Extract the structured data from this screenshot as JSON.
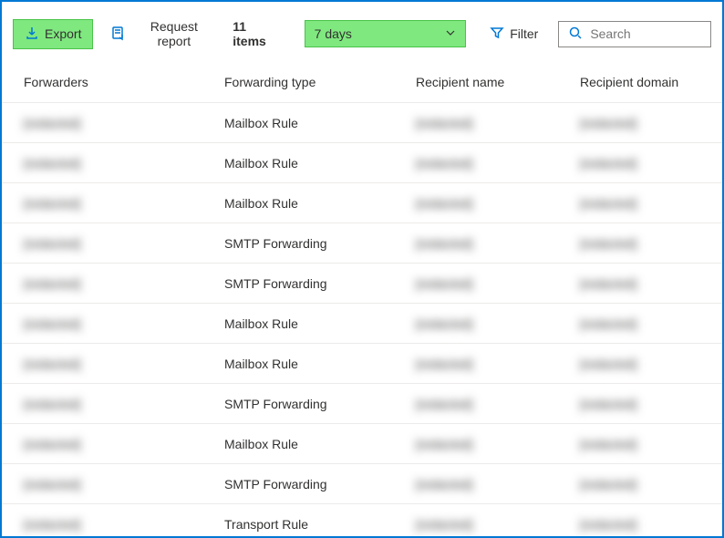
{
  "toolbar": {
    "export_label": "Export",
    "request_report_label": "Request report",
    "item_count": "11 items",
    "date_range": "7 days",
    "filter_label": "Filter",
    "search_placeholder": "Search"
  },
  "columns": {
    "forwarders": "Forwarders",
    "forwarding_type": "Forwarding type",
    "recipient_name": "Recipient name",
    "recipient_domain": "Recipient domain"
  },
  "rows": [
    {
      "forwarders": "[redacted]",
      "type": "Mailbox Rule",
      "name": "[redacted]",
      "domain": "[redacted]"
    },
    {
      "forwarders": "[redacted]",
      "type": "Mailbox Rule",
      "name": "[redacted]",
      "domain": "[redacted]"
    },
    {
      "forwarders": "[redacted]",
      "type": "Mailbox Rule",
      "name": "[redacted]",
      "domain": "[redacted]"
    },
    {
      "forwarders": "[redacted]",
      "type": "SMTP Forwarding",
      "name": "[redacted]",
      "domain": "[redacted]"
    },
    {
      "forwarders": "[redacted]",
      "type": "SMTP Forwarding",
      "name": "[redacted]",
      "domain": "[redacted]"
    },
    {
      "forwarders": "[redacted]",
      "type": "Mailbox Rule",
      "name": "[redacted]",
      "domain": "[redacted]"
    },
    {
      "forwarders": "[redacted]",
      "type": "Mailbox Rule",
      "name": "[redacted]",
      "domain": "[redacted]"
    },
    {
      "forwarders": "[redacted]",
      "type": "SMTP Forwarding",
      "name": "[redacted]",
      "domain": "[redacted]"
    },
    {
      "forwarders": "[redacted]",
      "type": "Mailbox Rule",
      "name": "[redacted]",
      "domain": "[redacted]"
    },
    {
      "forwarders": "[redacted]",
      "type": "SMTP Forwarding",
      "name": "[redacted]",
      "domain": "[redacted]"
    },
    {
      "forwarders": "[redacted]",
      "type": "Transport Rule",
      "name": "[redacted]",
      "domain": "[redacted]"
    }
  ]
}
